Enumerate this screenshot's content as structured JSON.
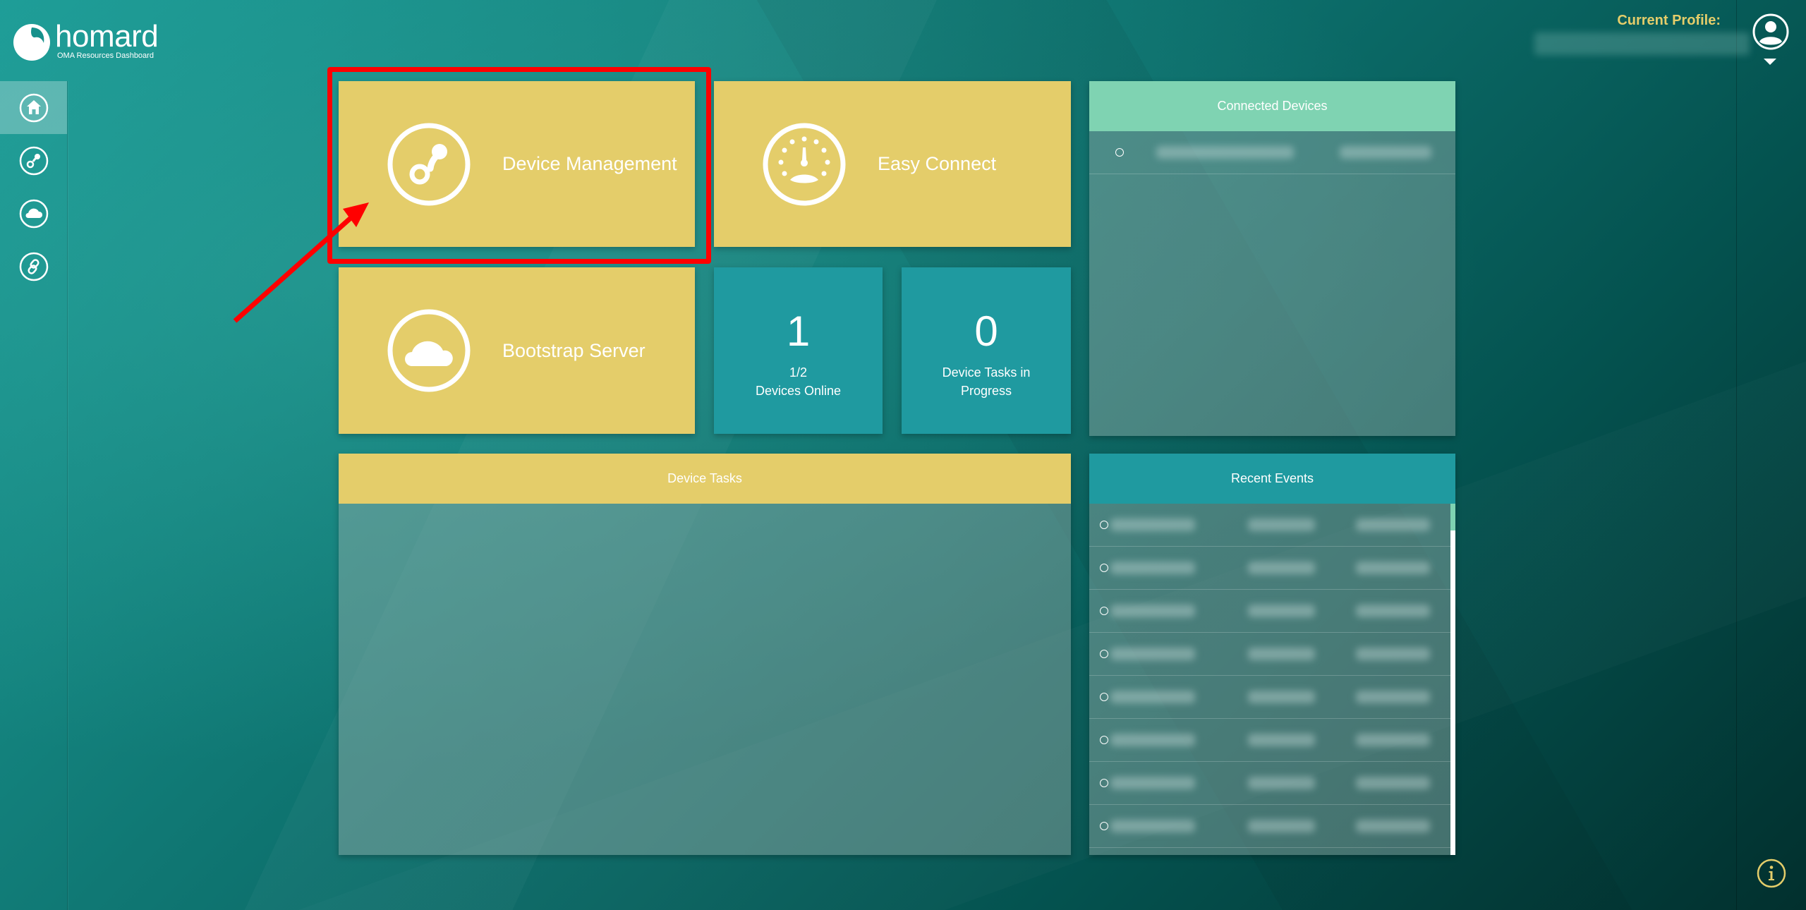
{
  "app": {
    "name": "homard",
    "subtitle": "OMA Resources Dashboard"
  },
  "colors": {
    "tile_yellow": "#e4cd6a",
    "tile_teal": "#1f9aa0",
    "connected_header": "#7fd3b2",
    "events_header": "#1f9aa0",
    "profile_label": "#e4cd6a",
    "highlight": "#ff0000"
  },
  "sidebar": {
    "items": [
      {
        "id": "home",
        "icon": "home-icon",
        "active": true
      },
      {
        "id": "device-management",
        "icon": "device-management-icon",
        "active": false
      },
      {
        "id": "bootstrap-server",
        "icon": "cloud-icon",
        "active": false
      },
      {
        "id": "easy-connect",
        "icon": "link-icon",
        "active": false
      }
    ]
  },
  "header": {
    "profile_label": "Current Profile:",
    "profile_value_redacted": true,
    "avatar_icon": "user-icon",
    "info_icon": "info-icon"
  },
  "tiles": {
    "device_management": {
      "label": "Device Management",
      "icon": "device-management-icon",
      "highlighted": true
    },
    "easy_connect": {
      "label": "Easy Connect",
      "icon": "gauge-icon"
    },
    "bootstrap_server": {
      "label": "Bootstrap Server",
      "icon": "cloud-icon"
    }
  },
  "stats": {
    "devices_online": {
      "value": "1",
      "fraction": "1/2",
      "label": "Devices Online"
    },
    "device_tasks": {
      "value": "0",
      "label": "Device Tasks in Progress"
    }
  },
  "panels": {
    "connected_devices": {
      "title": "Connected Devices",
      "rows_count": 1,
      "content_redacted": true
    },
    "device_tasks": {
      "title": "Device Tasks",
      "rows_count": 0
    },
    "recent_events": {
      "title": "Recent Events",
      "rows_count": 8,
      "content_redacted": true
    }
  },
  "annotation": {
    "type": "arrow-and-box",
    "target": "Device Management"
  }
}
